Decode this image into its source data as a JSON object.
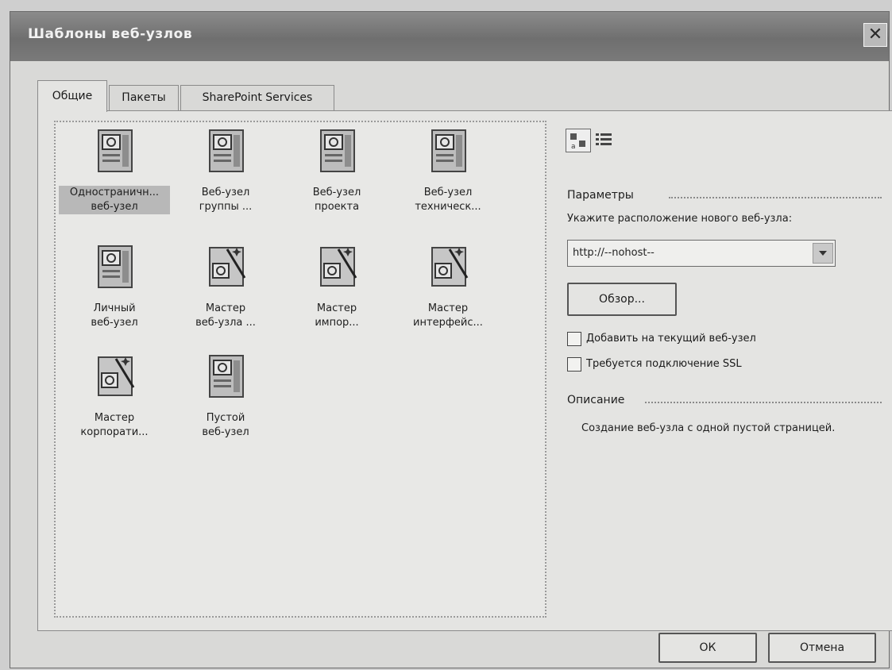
{
  "window": {
    "title": "Шаблоны веб-узлов",
    "close_glyph": "✕"
  },
  "tabs": [
    {
      "label": "Общие",
      "active": true
    },
    {
      "label": "Пакеты",
      "active": false
    },
    {
      "label": "SharePoint Services",
      "active": false
    }
  ],
  "templates": [
    {
      "label": "Одностраничный веб-узел",
      "line1": "Одностраничн...",
      "line2": "веб-узел",
      "icon": "web-page-icon",
      "selected": true
    },
    {
      "label": "Веб-узел группы",
      "line1": "Веб-узел",
      "line2": "группы ...",
      "icon": "web-page-icon",
      "selected": false
    },
    {
      "label": "Веб-узел проекта",
      "line1": "Веб-узел",
      "line2": "проекта",
      "icon": "web-page-icon",
      "selected": false
    },
    {
      "label": "Веб-узел технической поддержки",
      "line1": "Веб-узел",
      "line2": "техническ...",
      "icon": "web-page-icon",
      "selected": false
    },
    {
      "label": "Личный веб-узел",
      "line1": "Личный",
      "line2": "веб-узел",
      "icon": "web-page-icon",
      "selected": false
    },
    {
      "label": "Мастер веб-узла",
      "line1": "Мастер",
      "line2": "веб-узла ...",
      "icon": "wizard-icon",
      "selected": false
    },
    {
      "label": "Мастер импорта",
      "line1": "Мастер",
      "line2": "импор...",
      "icon": "wizard-icon",
      "selected": false
    },
    {
      "label": "Мастер интерфейса",
      "line1": "Мастер",
      "line2": "интерфейс...",
      "icon": "wizard-icon",
      "selected": false
    },
    {
      "label": "Мастер корпоративного",
      "line1": "Мастер",
      "line2": "корпорати...",
      "icon": "wizard-icon",
      "selected": false
    },
    {
      "label": "Пустой веб-узел",
      "line1": "Пустой",
      "line2": "веб-узел",
      "icon": "web-page-icon",
      "selected": false
    }
  ],
  "view_toggle": {
    "large_icons": "large-icons-view-icon",
    "list": "list-view-icon"
  },
  "options": {
    "heading": "Параметры",
    "location_label": "Укажите расположение нового веб-узла:",
    "location_value": "http://--nohost--",
    "browse_label": "Обзор...",
    "add_to_current_label": "Добавить на текущий веб-узел",
    "add_to_current_checked": false,
    "ssl_label": "Требуется подключение SSL",
    "ssl_checked": false
  },
  "description": {
    "heading": "Описание",
    "text": "Создание веб-узла с одной пустой страницей."
  },
  "footer": {
    "ok_label": "ОК",
    "cancel_label": "Отмена"
  }
}
